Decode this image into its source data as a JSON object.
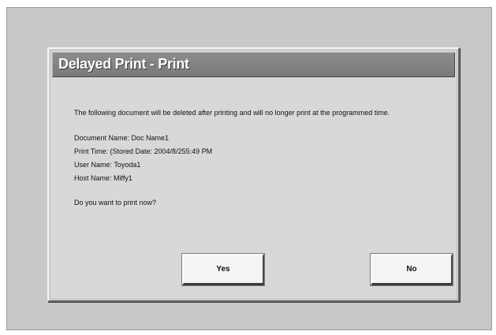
{
  "dialog": {
    "title": "Delayed Print - Print",
    "message": "The following document will be deleted after printing and will no longer print at the programmed time.",
    "details": [
      "Document Name: Doc Name1",
      "Print Time: (Stored Date: 2004/8/255:49 PM",
      "User Name: Toyoda1",
      "Host Name: Miffy1"
    ],
    "question": "Do you want to print now?",
    "yes_label": "Yes",
    "no_label": "No"
  },
  "colors": {
    "screen_background": "#c8c8c8",
    "dialog_background": "#d8d8d8",
    "titlebar_background": "#808080",
    "title_text": "#ffffff",
    "button_background": "#f4f4f4"
  }
}
